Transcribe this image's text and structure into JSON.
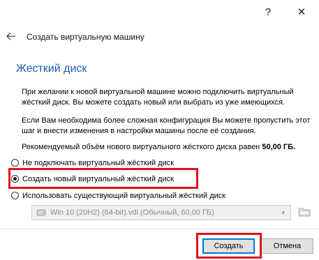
{
  "titlebar": {
    "help_label": "?",
    "close_label": "✕"
  },
  "header": {
    "back_icon": "back-arrow-icon",
    "title": "Создать виртуальную машину"
  },
  "section": {
    "title": "Жесткий диск"
  },
  "paragraphs": {
    "p1": "При желании к новой виртуальной машине можно подключить виртуальный жёсткий диск. Вы можете создать новый или выбрать из уже имеющихся.",
    "p2": "Если Вам необходима более сложная конфигурация Вы можете пропустить этот шаг и внести изменения в настройки машины после её создания.",
    "p3_text": "Рекомендуемый объём нового виртуального жёсткого диска равен ",
    "p3_size": "50,00 ГБ."
  },
  "radios": [
    {
      "label": "Не подключать виртуальный жёсткий диск",
      "checked": false
    },
    {
      "label": "Создать новый виртуальный жёсткий диск",
      "checked": true
    },
    {
      "label": "Использовать существующий виртуальный жёсткий диск",
      "checked": false
    }
  ],
  "disk_select": {
    "value": "Win 10 (20H2) (64-bit).vdi (Обычный, 60,00 ГБ)",
    "enabled": false
  },
  "buttons": {
    "create_label": "Создать",
    "cancel_label": "Отмена"
  },
  "colors": {
    "heading": "#1a5fa8",
    "highlight": "#e3101a",
    "default_button_border": "#0078d7"
  }
}
